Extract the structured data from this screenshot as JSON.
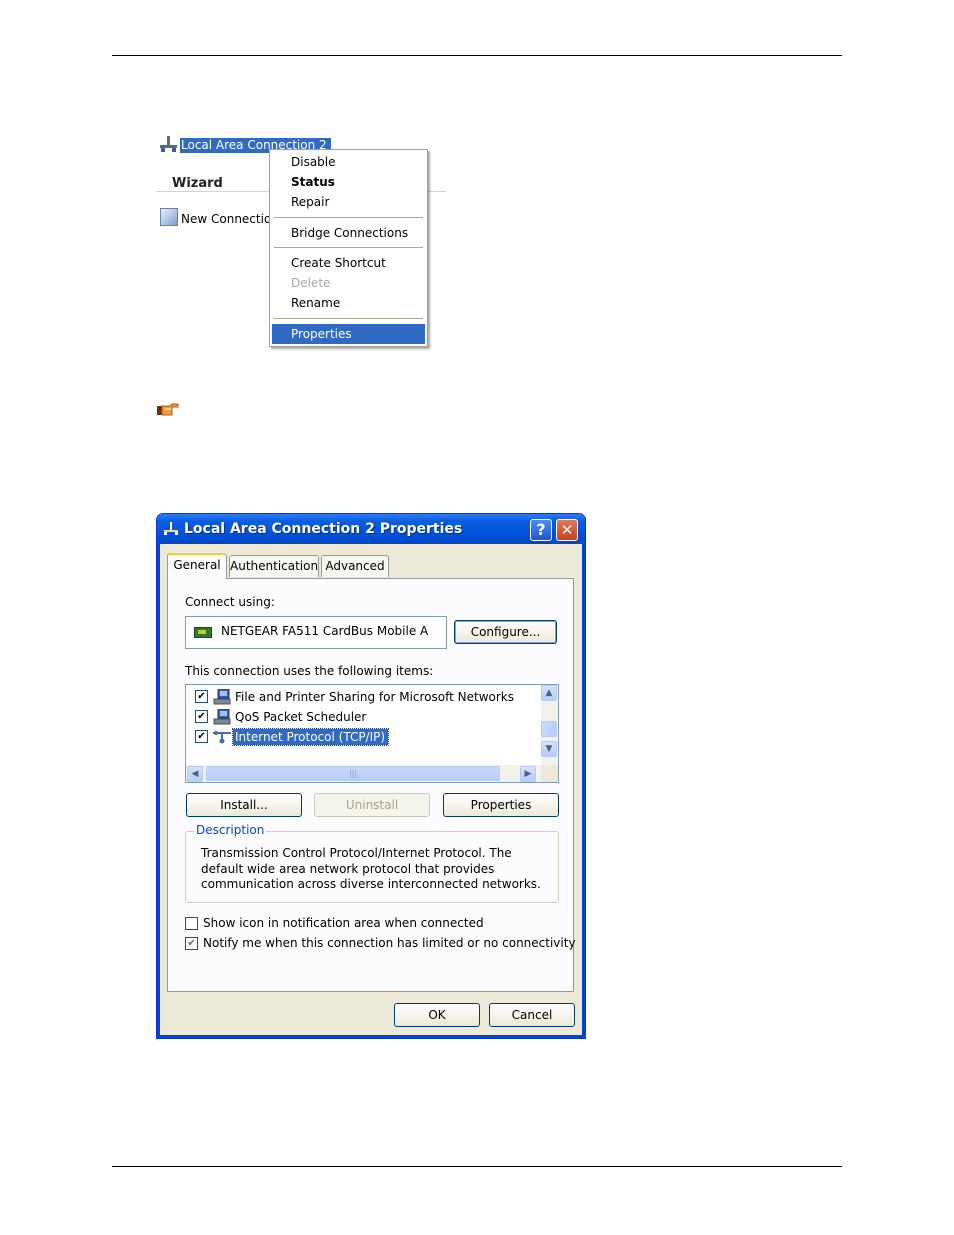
{
  "context_menu_screenshot": {
    "connection_label": "Local Area Connection 2",
    "wizard_label": "Wizard",
    "new_connection_label": "New Connection",
    "menu_items": [
      {
        "label": "Disable"
      },
      {
        "label": "Status",
        "bold": true
      },
      {
        "label": "Repair"
      },
      {
        "label": "Bridge Connections"
      },
      {
        "label": "Create Shortcut"
      },
      {
        "label": "Delete",
        "disabled": true
      },
      {
        "label": "Rename"
      },
      {
        "label": "Properties",
        "selected": true
      }
    ],
    "note_icon": "pointing-hand-icon"
  },
  "dialog": {
    "title": "Local Area Connection 2 Properties",
    "help_label": "?",
    "close_label": "✕",
    "tabs": [
      {
        "label": "General",
        "active": true
      },
      {
        "label": "Authentication"
      },
      {
        "label": "Advanced"
      }
    ],
    "connect_using_label": "Connect using:",
    "adapter_name": "NETGEAR FA511 CardBus Mobile A",
    "configure_label": "Configure...",
    "items_label": "This connection uses the following items:",
    "items": [
      {
        "label": "File and Printer Sharing for Microsoft Networks",
        "checked": true,
        "icon": "network-service-icon"
      },
      {
        "label": "QoS Packet Scheduler",
        "checked": true,
        "icon": "network-service-icon"
      },
      {
        "label": "Internet Protocol (TCP/IP)",
        "checked": true,
        "selected": true,
        "icon": "protocol-icon"
      }
    ],
    "install_label": "Install...",
    "uninstall_label": "Uninstall",
    "properties_label": "Properties",
    "description_title": "Description",
    "description_text": "Transmission Control Protocol/Internet Protocol. The default wide area network protocol that provides communication across diverse interconnected networks.",
    "show_icon_label": "Show icon in notification area when connected",
    "show_icon_checked": false,
    "notify_label": "Notify me when this connection has limited or no connectivity",
    "notify_checked": true,
    "ok_label": "OK",
    "cancel_label": "Cancel"
  },
  "colors": {
    "selection": "#316ac5",
    "title_bar": "#0a5ce0",
    "dialog_face": "#ece9d8"
  }
}
